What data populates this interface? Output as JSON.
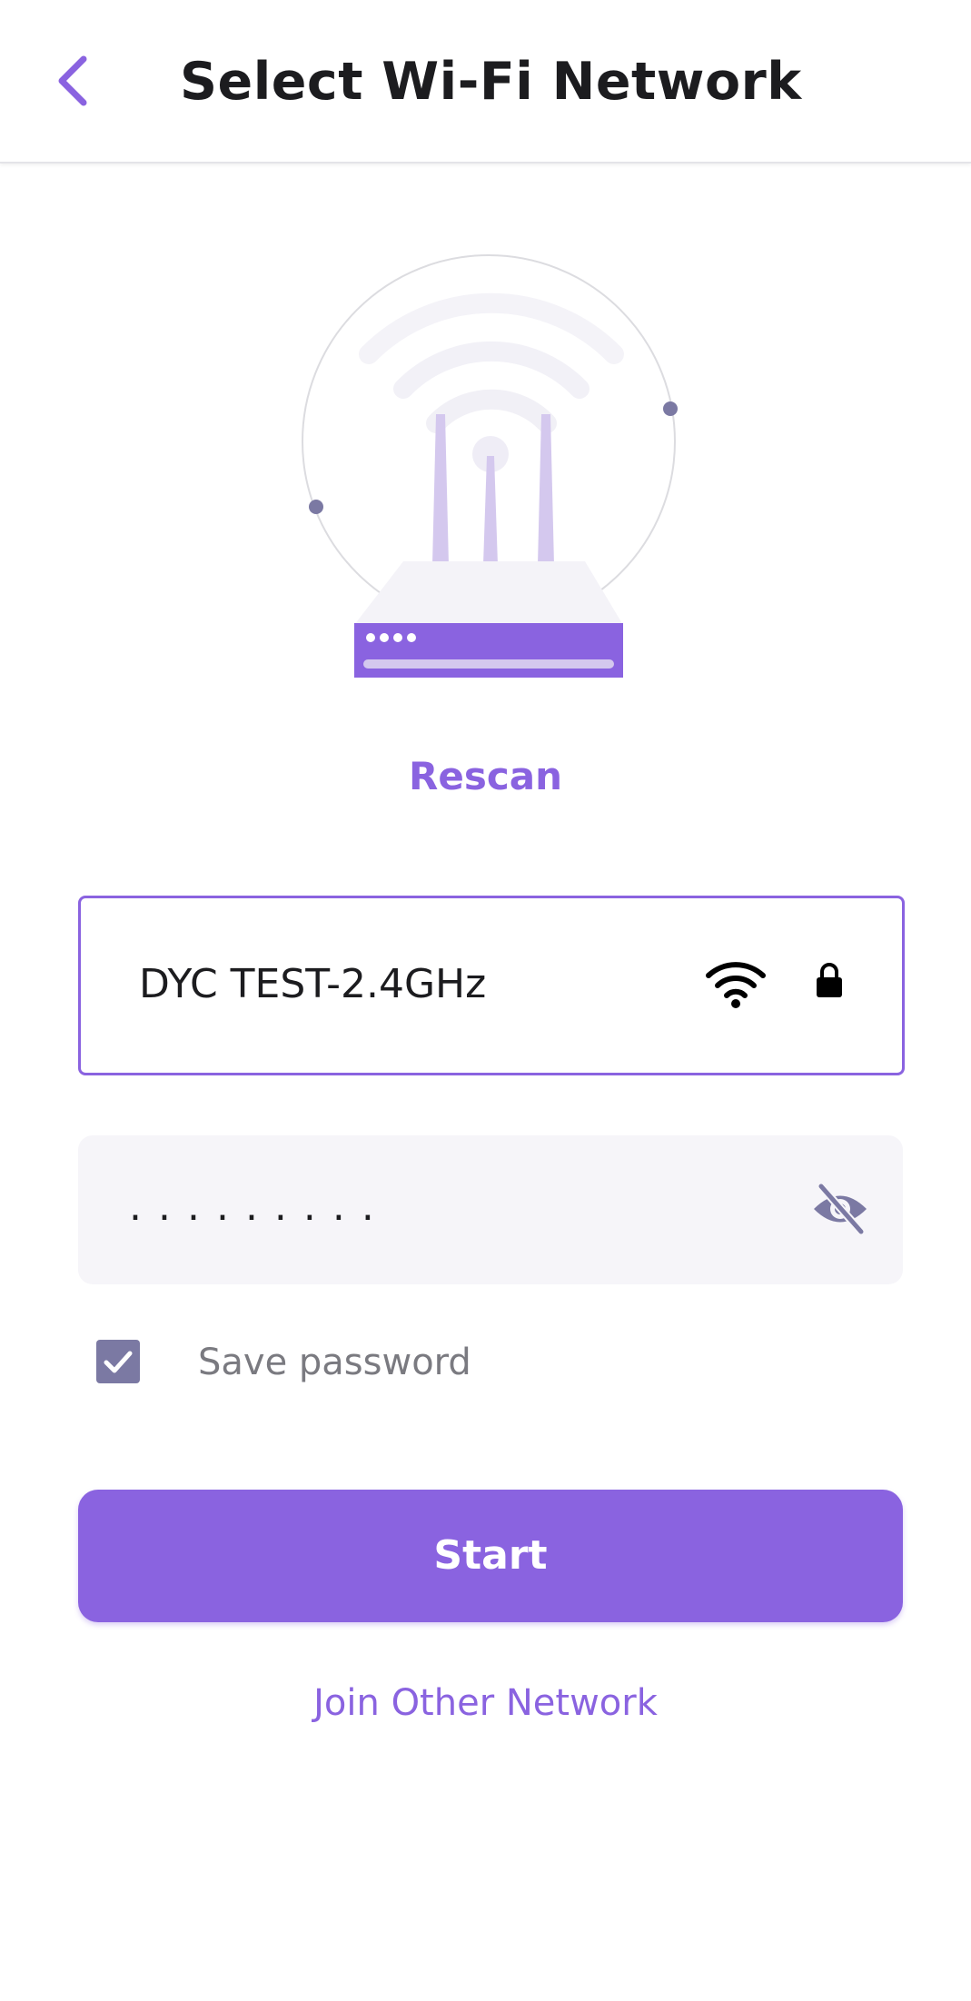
{
  "header": {
    "back_icon": "chevron-left-icon",
    "title": "Select Wi-Fi Network"
  },
  "illustration": {
    "icon": "router-icon"
  },
  "rescan_label": "Rescan",
  "network": {
    "ssid": "DYC TEST-2.4GHz",
    "signal_icon": "wifi-icon",
    "secure_icon": "lock-icon"
  },
  "password": {
    "masked_value": ".........",
    "toggle_icon": "eye-off-icon"
  },
  "save_password": {
    "label": "Save password",
    "checked": true
  },
  "start_label": "Start",
  "join_other_label": "Join Other Network",
  "colors": {
    "accent": "#8a63e0",
    "text": "#1c1c1f",
    "muted": "#7a7a80",
    "field_bg": "#f6f5f9",
    "checkbox": "#7b79a3"
  }
}
